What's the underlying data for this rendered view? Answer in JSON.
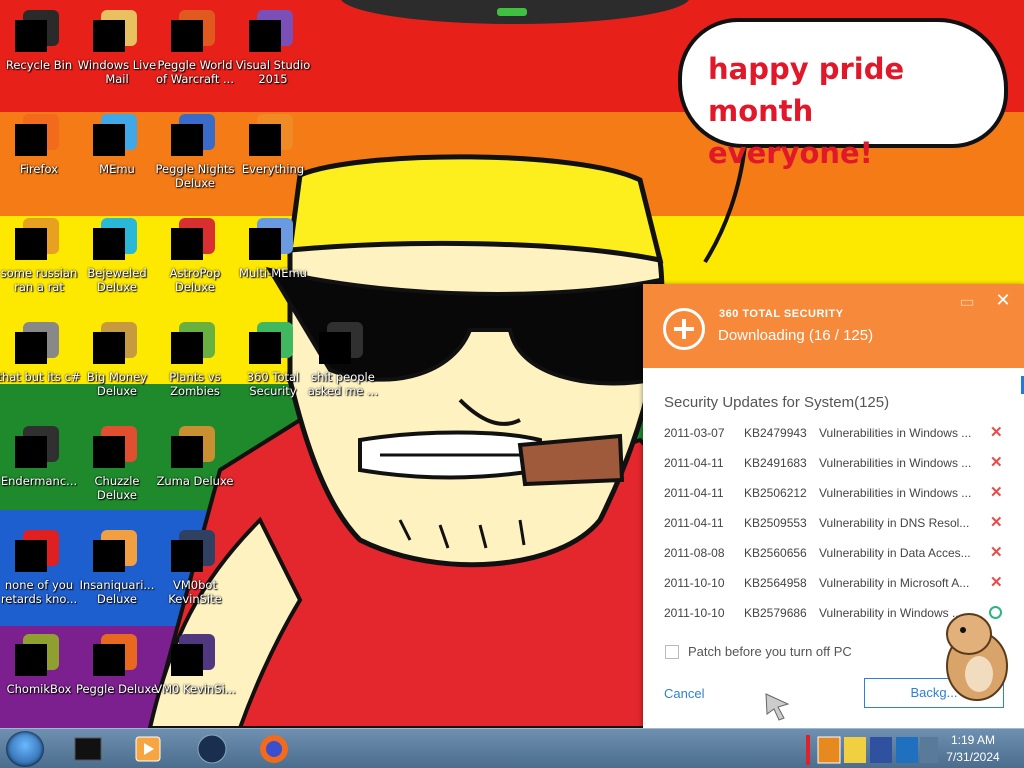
{
  "desktop": {
    "icons": [
      {
        "label": "Recycle Bin",
        "icon": "recycle-bin-icon",
        "color": "#2a2a2a"
      },
      {
        "label": "Windows Live Mail",
        "icon": "mail-icon",
        "color": "#e8c060"
      },
      {
        "label": "Peggle World of Warcraft ...",
        "icon": "peggle-icon",
        "color": "#e05a20"
      },
      {
        "label": "Visual Studio 2015",
        "icon": "visual-studio-icon",
        "color": "#7a4fb8"
      },
      {
        "label": "Firefox",
        "icon": "firefox-icon",
        "color": "#f26a1b"
      },
      {
        "label": "MEmu",
        "icon": "memu-icon",
        "color": "#41a8e8"
      },
      {
        "label": "Peggle Nights Deluxe",
        "icon": "peggle-icon",
        "color": "#3a6bc8"
      },
      {
        "label": "Everything",
        "icon": "search-icon",
        "color": "#f08a24"
      },
      {
        "label": "some russian ran a rat",
        "icon": "document-icon",
        "color": "#e8a020"
      },
      {
        "label": "Bejeweled Deluxe",
        "icon": "gem-icon",
        "color": "#2ab8d8"
      },
      {
        "label": "AstroPop Deluxe",
        "icon": "astropop-icon",
        "color": "#d83030"
      },
      {
        "label": "Multi-MEmu",
        "icon": "memu-icon",
        "color": "#6a9ae0"
      },
      {
        "label": "that but its c#",
        "icon": "document-icon",
        "color": "#888888"
      },
      {
        "label": "Big Money Deluxe",
        "icon": "money-bag-icon",
        "color": "#c89a40"
      },
      {
        "label": "Plants vs Zombies",
        "icon": "plant-icon",
        "color": "#68b040"
      },
      {
        "label": "360 Total Security",
        "icon": "shield-icon",
        "color": "#40b860"
      },
      {
        "label": "Endermanc...",
        "icon": "terminal-icon",
        "color": "#303030"
      },
      {
        "label": "Chuzzle Deluxe",
        "icon": "chuzzle-icon",
        "color": "#e05030"
      },
      {
        "label": "Zuma Deluxe",
        "icon": "zuma-icon",
        "color": "#c89030"
      },
      {
        "label": "none of you retards kno...",
        "icon": "opera-icon",
        "color": "#e02020"
      },
      {
        "label": "Insaniquari... Deluxe",
        "icon": "fish-icon",
        "color": "#f0a040"
      },
      {
        "label": "VM0bot KevinSite",
        "icon": "monitor-icon",
        "color": "#304060"
      },
      {
        "label": "ChomikBox",
        "icon": "hamster-icon",
        "color": "#90a030"
      },
      {
        "label": "Peggle Deluxe",
        "icon": "peggle-icon",
        "color": "#e86820"
      },
      {
        "label": "VM0 KevinSi...",
        "icon": "file-icon",
        "color": "#503880"
      },
      {
        "label": "shit people asked me ...",
        "icon": "folder-icon",
        "color": "#303030"
      }
    ],
    "speech_bubble": {
      "line1": "happy pride month",
      "line2": "everyone!"
    }
  },
  "popup": {
    "brand": "360 TOTAL SECURITY",
    "status": "Downloading (16 / 125)",
    "progress": {
      "done": 16,
      "total": 125
    },
    "section_title": "Security Updates for System(125)",
    "updates": [
      {
        "date": "2011-03-07",
        "kb": "KB2479943",
        "desc": "Vulnerabilities in Windows ...",
        "state": "failed"
      },
      {
        "date": "2011-04-11",
        "kb": "KB2491683",
        "desc": "Vulnerabilities in Windows ...",
        "state": "failed"
      },
      {
        "date": "2011-04-11",
        "kb": "KB2506212",
        "desc": "Vulnerabilities in Windows ...",
        "state": "failed"
      },
      {
        "date": "2011-04-11",
        "kb": "KB2509553",
        "desc": "Vulnerability in DNS Resol...",
        "state": "failed"
      },
      {
        "date": "2011-08-08",
        "kb": "KB2560656",
        "desc": "Vulnerability in Data Acces...",
        "state": "failed"
      },
      {
        "date": "2011-10-10",
        "kb": "KB2564958",
        "desc": "Vulnerability in Microsoft A...",
        "state": "failed"
      },
      {
        "date": "2011-10-10",
        "kb": "KB2579686",
        "desc": "Vulnerability in Windows ...",
        "state": "pending"
      }
    ],
    "patch_label": "Patch before you turn off PC",
    "cancel_label": "Cancel",
    "background_label": "Backg..."
  },
  "taskbar": {
    "apps": [
      "terminal-icon",
      "media-player-icon",
      "network-icon",
      "firefox-icon"
    ],
    "time": "1:19 AM",
    "date": "7/31/2024"
  },
  "colors": {
    "accent_orange": "#f7893b",
    "link_blue": "#2d7fd8",
    "error_red": "#e74c4c",
    "ok_green": "#30b37e"
  }
}
